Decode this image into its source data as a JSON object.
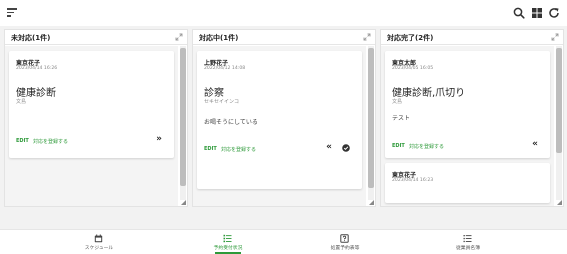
{
  "topbar": {
    "menu_icon": "sort-menu-icon",
    "search_icon": "search-icon",
    "grid_icon": "grid-icon",
    "refresh_icon": "refresh-icon"
  },
  "columns": [
    {
      "title": "未対応(1件)",
      "cards": [
        {
          "name": "東京花子",
          "date": "2023/04/14 16:26",
          "main": "健康診断",
          "sub": "文島",
          "edit": "EDIT",
          "register": "対応を登録する",
          "actions": [
            "»"
          ]
        }
      ]
    },
    {
      "title": "対応中(1件)",
      "cards": [
        {
          "name": "上野花子",
          "date": "2022/04/12 14:08",
          "main": "診察",
          "sub": "セキセイインコ",
          "note": "お喝そうにしている",
          "edit": "EDIT",
          "register": "対応を登録する",
          "actions": [
            "«",
            "check"
          ]
        }
      ]
    },
    {
      "title": "対応完了(2件)",
      "cards": [
        {
          "name": "東京太郎",
          "date": "2023/04/05 16:05",
          "main": "健康診断,爪切り",
          "sub": "文島",
          "note": "テスト",
          "edit": "EDIT",
          "register": "対応を登録する",
          "actions": [
            "«"
          ]
        },
        {
          "name": "東京花子",
          "date": "2023/04/14 16:23"
        }
      ]
    }
  ],
  "bottom_nav": [
    {
      "label": "スケジュール",
      "icon": "calendar-icon",
      "active": false
    },
    {
      "label": "予約受付状況",
      "icon": "list-check-icon",
      "active": true
    },
    {
      "label": "処置予約表等",
      "icon": "help-box-icon",
      "active": false
    },
    {
      "label": "従業員名簿",
      "icon": "list-icon",
      "active": false
    }
  ],
  "colors": {
    "accent": "#2e9a3a",
    "background": "#f2f2f2"
  }
}
